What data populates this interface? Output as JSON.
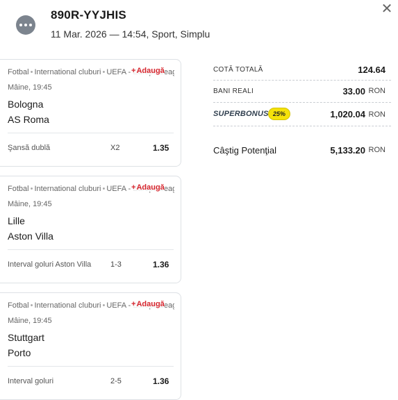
{
  "header": {
    "ticket_code": "890R-YYJHIS",
    "subtitle": "11 Mar. 2026 — 14:54, Sport, Simplu",
    "more_icon": "more-dots-icon",
    "close_icon": "close-icon",
    "close_glyph": "✕"
  },
  "add_label": "Adaugă",
  "crumb_sport": "Fotbal",
  "crumb_category": "International cluburi",
  "crumb_tournament": "UEFA - Europa League",
  "bets": [
    {
      "time": "Mâine, 19:45",
      "team1": "Bologna",
      "team2": "AS Roma",
      "market": "Şansă dublă",
      "pick": "X2",
      "odd": "1.35"
    },
    {
      "time": "Mâine, 19:45",
      "team1": "Lille",
      "team2": "Aston Villa",
      "market": "Interval goluri Aston Villa",
      "pick": "1-3",
      "odd": "1.36"
    },
    {
      "time": "Mâine, 19:45",
      "team1": "Stuttgart",
      "team2": "Porto",
      "market": "Interval goluri",
      "pick": "2-5",
      "odd": "1.36"
    }
  ],
  "summary": {
    "total_odds_label": "COTĂ TOTALĂ",
    "total_odds_value": "124.64",
    "real_money_label": "BANI REALI",
    "real_money_value": "33.00",
    "currency": "RON",
    "superbonus_label": "SUPERBONUS",
    "superbonus_percent": "25%",
    "superbonus_value": "1,020.04",
    "potential_label": "Câştig Potenţial",
    "potential_value": "5,133.20"
  },
  "colors": {
    "accent_red": "#d7262e",
    "badge_yellow": "#f5e20a",
    "more_button_grey": "#7c848e"
  }
}
